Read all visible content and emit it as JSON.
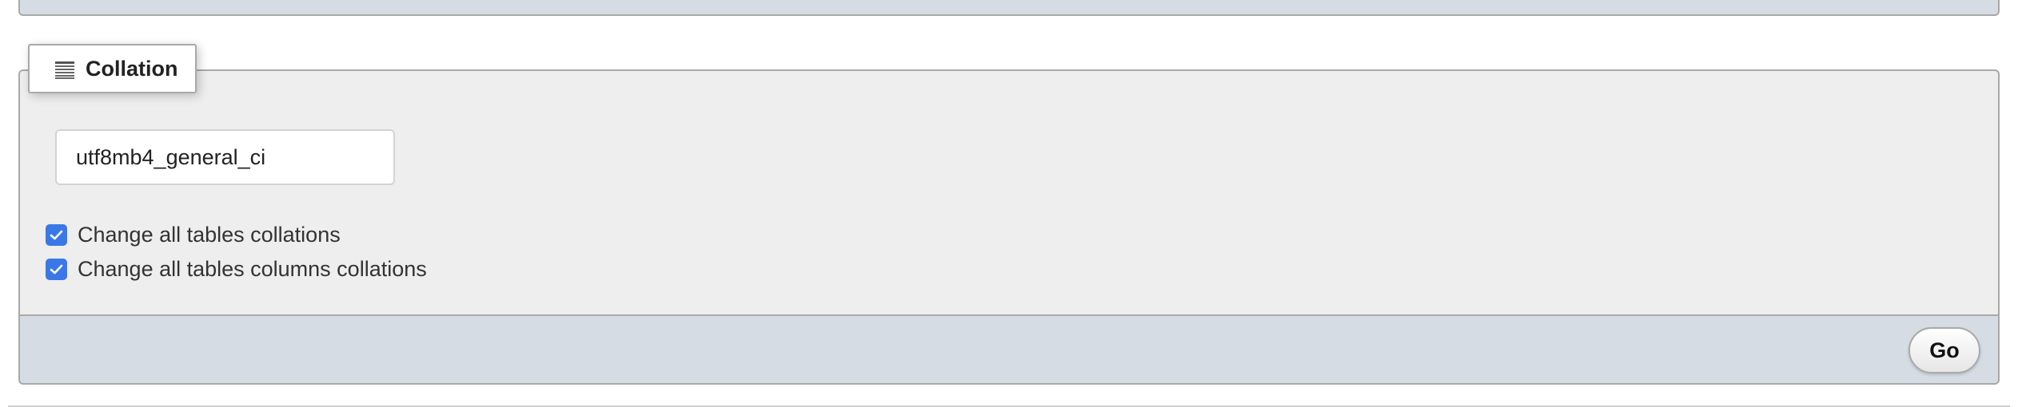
{
  "collation_fieldset": {
    "legend_icon": "table-rows-icon",
    "legend_title": "Collation",
    "selected_collation": "utf8mb4_general_ci",
    "checkboxes": [
      {
        "label": "Change all tables collations",
        "checked": true
      },
      {
        "label": "Change all tables columns collations",
        "checked": true
      }
    ]
  },
  "footer": {
    "go_label": "Go"
  },
  "colors": {
    "fieldset_bg": "#eeeeee",
    "footer_bg": "#d5dce3",
    "checkbox_accent": "#3b78e7"
  }
}
